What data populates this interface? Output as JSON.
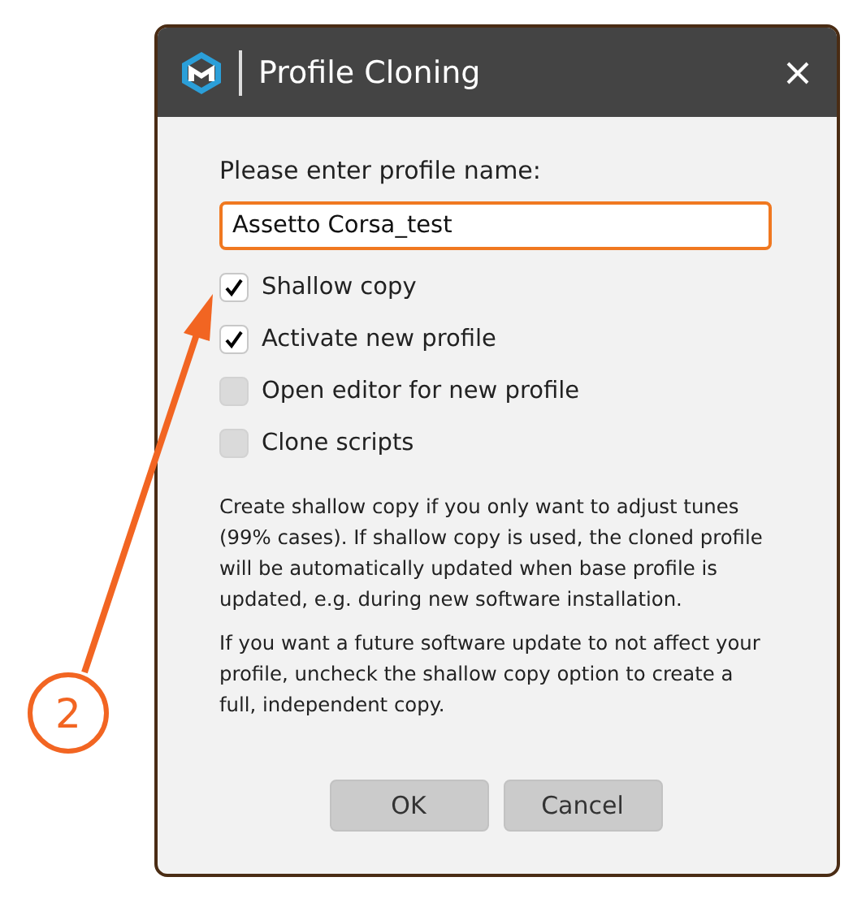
{
  "window": {
    "title": "Profile Cloning"
  },
  "prompt": "Please enter profile name:",
  "name_field": {
    "value": "Assetto Corsa_test",
    "focused": true
  },
  "options": [
    {
      "label": "Shallow copy",
      "checked": true
    },
    {
      "label": "Activate new profile",
      "checked": true
    },
    {
      "label": "Open editor for new profile",
      "checked": false
    },
    {
      "label": "Clone scripts",
      "checked": false
    }
  ],
  "notes": [
    "Create shallow copy if you only want to adjust tunes (99% cases). If shallow copy is used, the cloned profile will be automatically updated when base profile is updated, e.g. during new software installation.",
    "If you want a future software update to not affect your profile, uncheck the shallow copy option to create a full, independent copy."
  ],
  "buttons": [
    "OK",
    "Cancel"
  ],
  "annotation": {
    "label": "2"
  }
}
